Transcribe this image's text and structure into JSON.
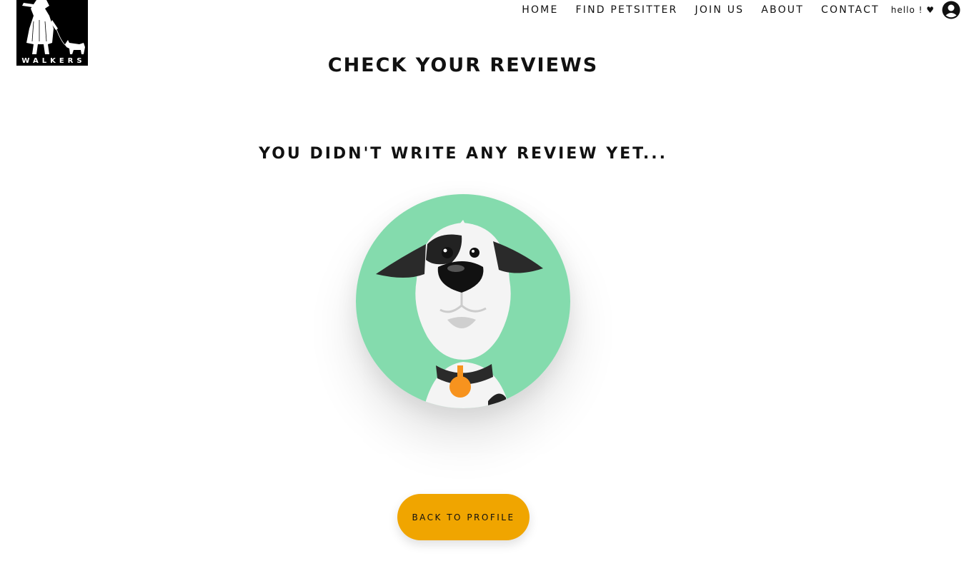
{
  "logo": {
    "text": "WALKERS"
  },
  "nav": {
    "items": [
      {
        "label": "HOME"
      },
      {
        "label": "FIND PETSITTER"
      },
      {
        "label": "JOIN US"
      },
      {
        "label": "ABOUT"
      },
      {
        "label": "CONTACT"
      }
    ],
    "greeting": "hello ! ♥",
    "user_icon": "user-circle-icon"
  },
  "main": {
    "title": "CHECK YOUR REVIEWS",
    "empty_message": "YOU DIDN'T WRITE ANY REVIEW YET...",
    "illustration": "dog-illustration",
    "back_button_label": "BACK TO PROFILE"
  },
  "colors": {
    "accent_button": "#f0a500",
    "illustration_bg": "#84dbad",
    "tag": "#f7931e"
  }
}
